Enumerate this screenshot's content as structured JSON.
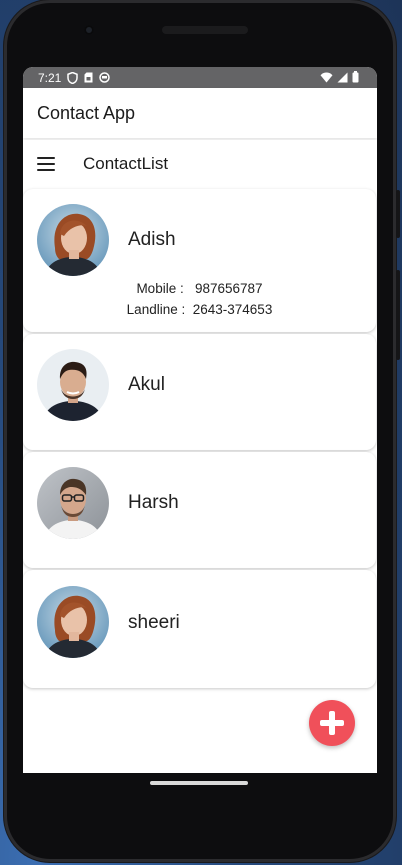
{
  "status_bar": {
    "time": "7:21"
  },
  "app_bar": {
    "title": "Contact App"
  },
  "toolbar": {
    "title": "ContactList"
  },
  "contacts": [
    {
      "name": "Adish",
      "mobile_label": "Mobile :",
      "mobile": "987656787",
      "landline_label": "Landline :",
      "landline": "2643-374653"
    },
    {
      "name": "Akul"
    },
    {
      "name": "Harsh"
    },
    {
      "name": "sheeri"
    }
  ],
  "colors": {
    "fab": "#f0505a",
    "status_bar": "#646466"
  },
  "icons": [
    "signal-icon",
    "wifi-icon",
    "battery-icon",
    "menu-icon",
    "add-icon"
  ]
}
